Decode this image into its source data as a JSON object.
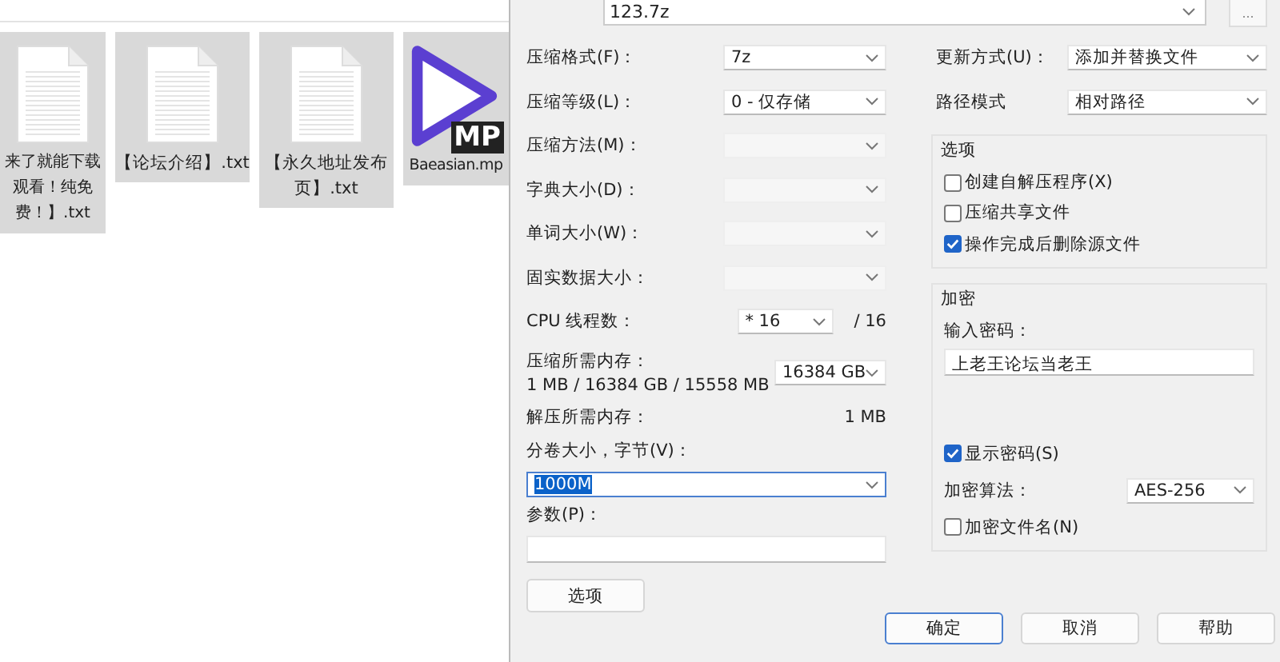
{
  "explorer": {
    "files": [
      {
        "kind": "text",
        "name_lines": [
          "来了就能下载",
          "观看！纯免",
          "费！】.txt"
        ],
        "selected": true
      },
      {
        "kind": "text",
        "name_lines": [
          "【论坛介绍】.txt"
        ],
        "selected": true
      },
      {
        "kind": "text",
        "name_lines": [
          "【永久地址发布",
          "页】.txt"
        ],
        "selected": true
      },
      {
        "kind": "video",
        "badge": "MP",
        "name_lines": [
          "Baeasian.mp"
        ],
        "selected": true
      }
    ]
  },
  "dialog": {
    "archive_name": "123.7z",
    "browse": "...",
    "settings": [
      {
        "kind": "select",
        "label": "压缩格式(F)：",
        "value": "7z",
        "disabled": false
      },
      {
        "kind": "select",
        "label": "压缩等级(L)：",
        "value": "0 - 仅存储",
        "disabled": false
      },
      {
        "kind": "select",
        "label": "压缩方法(M)：",
        "disabled": true
      },
      {
        "kind": "select",
        "label": "字典大小(D)：",
        "disabled": true
      },
      {
        "kind": "select",
        "label": "单词大小(W)：",
        "disabled": true
      },
      {
        "kind": "select",
        "label": "固实数据大小：",
        "disabled": true
      },
      {
        "kind": "threads",
        "label": "CPU 线程数：",
        "value": "* 16",
        "suffix": "/ 16"
      },
      {
        "kind": "memory",
        "label": "压缩所需内存：",
        "detail": "1 MB / 16384 GB / 15558 MB",
        "value": "16384 GB"
      },
      {
        "kind": "info",
        "label": "解压所需内存：",
        "value": "1 MB"
      },
      {
        "kind": "combo",
        "label": "分卷大小，字节(V)：",
        "value": "1000M",
        "highlighted": true
      },
      {
        "kind": "text",
        "label": "参数(P)："
      }
    ],
    "options_button": "选项",
    "update": {
      "label": "更新方式(U)：",
      "value": "添加并替换文件"
    },
    "path": {
      "label": "路径模式",
      "value": "相对路径"
    },
    "options": {
      "title": "选项",
      "checkboxes": [
        {
          "label": "创建自解压程序(X)",
          "checked": false
        },
        {
          "label": "压缩共享文件",
          "checked": false
        },
        {
          "label": "操作完成后删除源文件",
          "checked": true
        }
      ]
    },
    "encryption": {
      "title": "加密",
      "password_label": "输入密码：",
      "password": "上老王论坛当老王",
      "show_password": {
        "label": "显示密码(S)",
        "checked": true
      },
      "method_label": "加密算法：",
      "method": "AES-256",
      "encrypt_names": {
        "label": "加密文件名(N)",
        "checked": false
      }
    },
    "buttons": [
      {
        "label": "确定",
        "default": true
      },
      {
        "label": "取消",
        "default": false
      },
      {
        "label": "帮助",
        "default": false
      }
    ]
  }
}
